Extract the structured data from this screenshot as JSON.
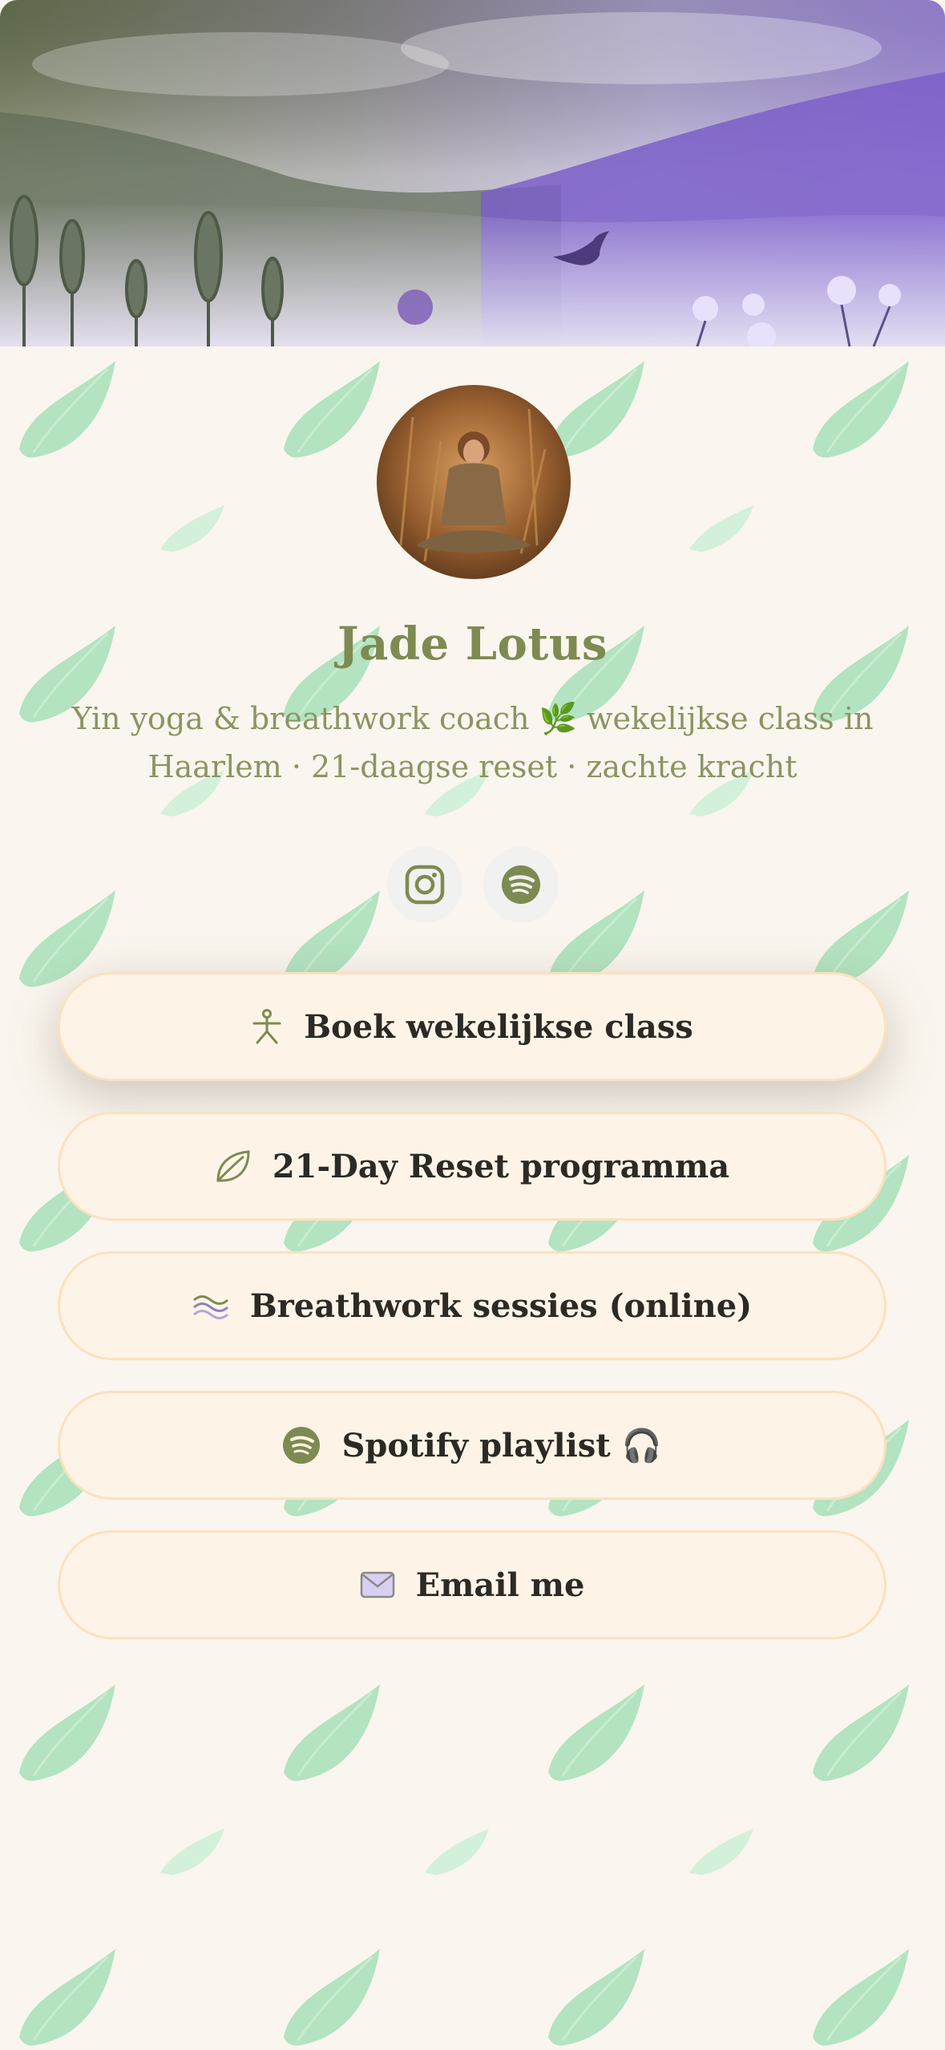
{
  "profile": {
    "name": "Jade Lotus",
    "bio_line1": "Yin yoga & breathwork coach 🌿  wekelijkse class in",
    "bio_line2": "Haarlem · 21-daagse reset · zachte kracht"
  },
  "socials": [
    {
      "name": "instagram-icon"
    },
    {
      "name": "spotify-icon"
    }
  ],
  "links": [
    {
      "label": "Boek wekelijkse class",
      "icon": "person-icon"
    },
    {
      "label": "21-Day Reset programma",
      "icon": "leaf-icon"
    },
    {
      "label": "Breathwork sessies (online)",
      "icon": "waves-icon"
    },
    {
      "label": "Spotify playlist 🎧",
      "icon": "spotify-icon"
    },
    {
      "label": "Email me",
      "icon": "envelope-icon"
    }
  ],
  "colors": {
    "background": "#faf5ee",
    "accent_green": "#7d8a52",
    "leaf_green": "#b3e3c1",
    "button_fill": "#fdf4e7",
    "button_border": "#fbe1bf",
    "banner_purple": "#8a6fd6"
  }
}
